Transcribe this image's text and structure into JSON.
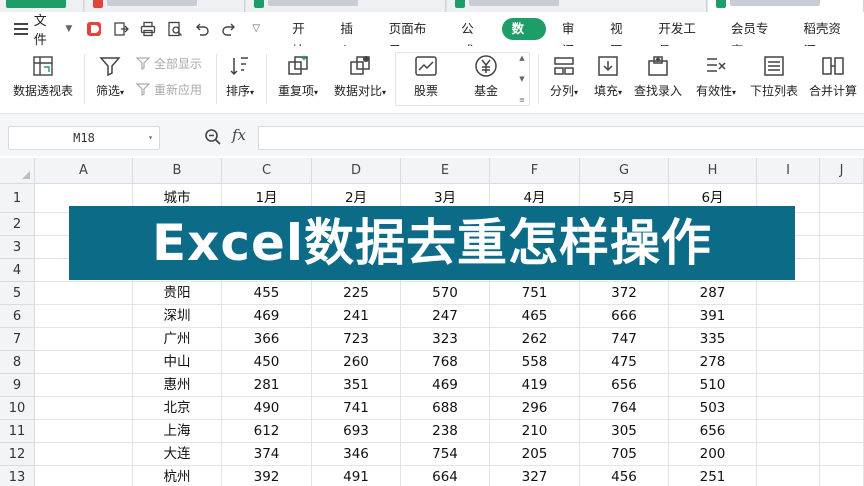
{
  "colors": {
    "accent": "#1f9d68",
    "banner_bg": "#0c6b86",
    "banner_text": "#ffffff"
  },
  "menubar": {
    "file_label": "文件",
    "quick_icons": [
      "docer-icon",
      "export-icon",
      "print-icon",
      "preview-icon",
      "undo-icon",
      "redo-icon",
      "more-icon"
    ],
    "tabs": [
      {
        "label": "开始",
        "active": false
      },
      {
        "label": "插入",
        "active": false
      },
      {
        "label": "页面布局",
        "active": false
      },
      {
        "label": "公式",
        "active": false
      },
      {
        "label": "数据",
        "active": true
      },
      {
        "label": "审阅",
        "active": false
      },
      {
        "label": "视图",
        "active": false
      },
      {
        "label": "开发工具",
        "active": false
      },
      {
        "label": "会员专享",
        "active": false
      },
      {
        "label": "稻壳资源",
        "active": false
      }
    ]
  },
  "ribbon": {
    "pivot": "数据透视表",
    "filter": "筛选",
    "show_all": "全部显示",
    "reapply": "重新应用",
    "sort": "排序",
    "duplicates": "重复项",
    "compare": "数据对比",
    "stock": "股票",
    "fund": "基金",
    "split": "分列",
    "fill": "填充",
    "lookup": "查找录入",
    "validity": "有效性",
    "dropdown": "下拉列表",
    "consolidate": "合并计算"
  },
  "formula_bar": {
    "name_box": "M18",
    "fx_label": "fx",
    "formula": ""
  },
  "grid": {
    "columns": [
      "A",
      "B",
      "C",
      "D",
      "E",
      "F",
      "G",
      "H",
      "I",
      "J"
    ],
    "rows": [
      {
        "num": "1",
        "cells": [
          "",
          "城市",
          "1月",
          "2月",
          "3月",
          "4月",
          "5月",
          "6月",
          "",
          ""
        ]
      },
      {
        "num": "2",
        "cells": [
          "",
          "",
          "",
          "",
          "",
          "",
          "",
          "",
          "",
          ""
        ]
      },
      {
        "num": "3",
        "cells": [
          "",
          "",
          "",
          "",
          "",
          "",
          "",
          "",
          "",
          ""
        ]
      },
      {
        "num": "4",
        "cells": [
          "",
          "",
          "",
          "",
          "",
          "",
          "",
          "",
          "",
          ""
        ]
      },
      {
        "num": "5",
        "cells": [
          "",
          "贵阳",
          "455",
          "225",
          "570",
          "751",
          "372",
          "287",
          "",
          ""
        ]
      },
      {
        "num": "6",
        "cells": [
          "",
          "深圳",
          "469",
          "241",
          "247",
          "465",
          "666",
          "391",
          "",
          ""
        ]
      },
      {
        "num": "7",
        "cells": [
          "",
          "广州",
          "366",
          "723",
          "323",
          "262",
          "747",
          "335",
          "",
          ""
        ]
      },
      {
        "num": "8",
        "cells": [
          "",
          "中山",
          "450",
          "260",
          "768",
          "558",
          "475",
          "278",
          "",
          ""
        ]
      },
      {
        "num": "9",
        "cells": [
          "",
          "惠州",
          "281",
          "351",
          "469",
          "419",
          "656",
          "510",
          "",
          ""
        ]
      },
      {
        "num": "10",
        "cells": [
          "",
          "北京",
          "490",
          "741",
          "688",
          "296",
          "764",
          "503",
          "",
          ""
        ]
      },
      {
        "num": "11",
        "cells": [
          "",
          "上海",
          "612",
          "693",
          "238",
          "210",
          "305",
          "656",
          "",
          ""
        ]
      },
      {
        "num": "12",
        "cells": [
          "",
          "大连",
          "374",
          "346",
          "754",
          "205",
          "705",
          "200",
          "",
          ""
        ]
      },
      {
        "num": "13",
        "cells": [
          "",
          "杭州",
          "392",
          "491",
          "664",
          "327",
          "456",
          "251",
          "",
          ""
        ]
      }
    ]
  },
  "banner": {
    "text": "Excel数据去重怎样操作"
  }
}
